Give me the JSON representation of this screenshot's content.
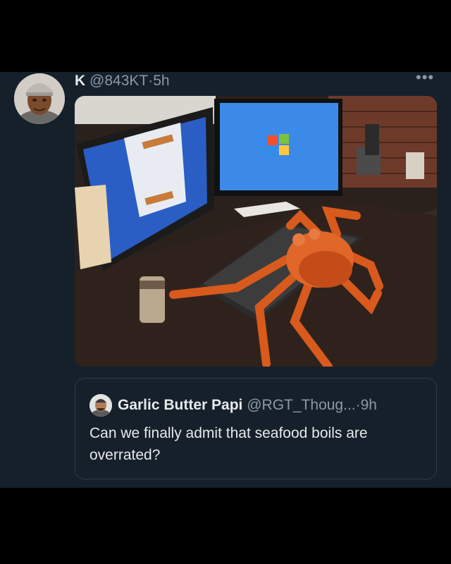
{
  "tweet": {
    "display_name": "K",
    "handle": "@843KT",
    "separator": "·",
    "time": "5h",
    "more_label": "•••",
    "image_alt": "Photo of a giant king crab sitting on a computer desk keyboard in front of two monitors"
  },
  "quoted_tweet": {
    "display_name": "Garlic Butter Papi",
    "handle": "@RGT_Thoug...",
    "separator": "·",
    "time": "9h",
    "text": "Can we finally admit that seafood boils are overrated?"
  },
  "colors": {
    "background": "#15202b",
    "outer": "#000000",
    "text": "#e7e9ea",
    "muted": "#8b98a5",
    "border": "#2f3b45"
  }
}
